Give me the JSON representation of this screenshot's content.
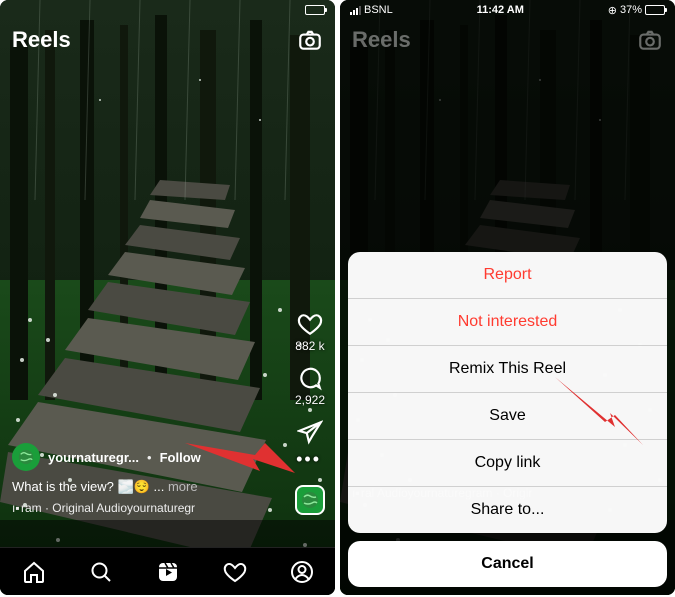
{
  "status": {
    "carrier": "BSNL",
    "time": "11:42 AM",
    "battery": "37%",
    "orientation_lock": "⊕"
  },
  "header": {
    "title": "Reels"
  },
  "reel": {
    "username": "yournaturegr...",
    "follow": "Follow",
    "caption": "What is the view?",
    "caption_more": "more",
    "audio_line": "ram · Original Audioyournaturegr",
    "likes": "882 k",
    "comments": "2,922"
  },
  "audio_line2": "ral Audioyournaturegram · Origir",
  "action_sheet": {
    "report": "Report",
    "not_interested": "Not interested",
    "remix": "Remix This Reel",
    "save": "Save",
    "copy_link": "Copy link",
    "share_to": "Share to...",
    "cancel": "Cancel"
  }
}
